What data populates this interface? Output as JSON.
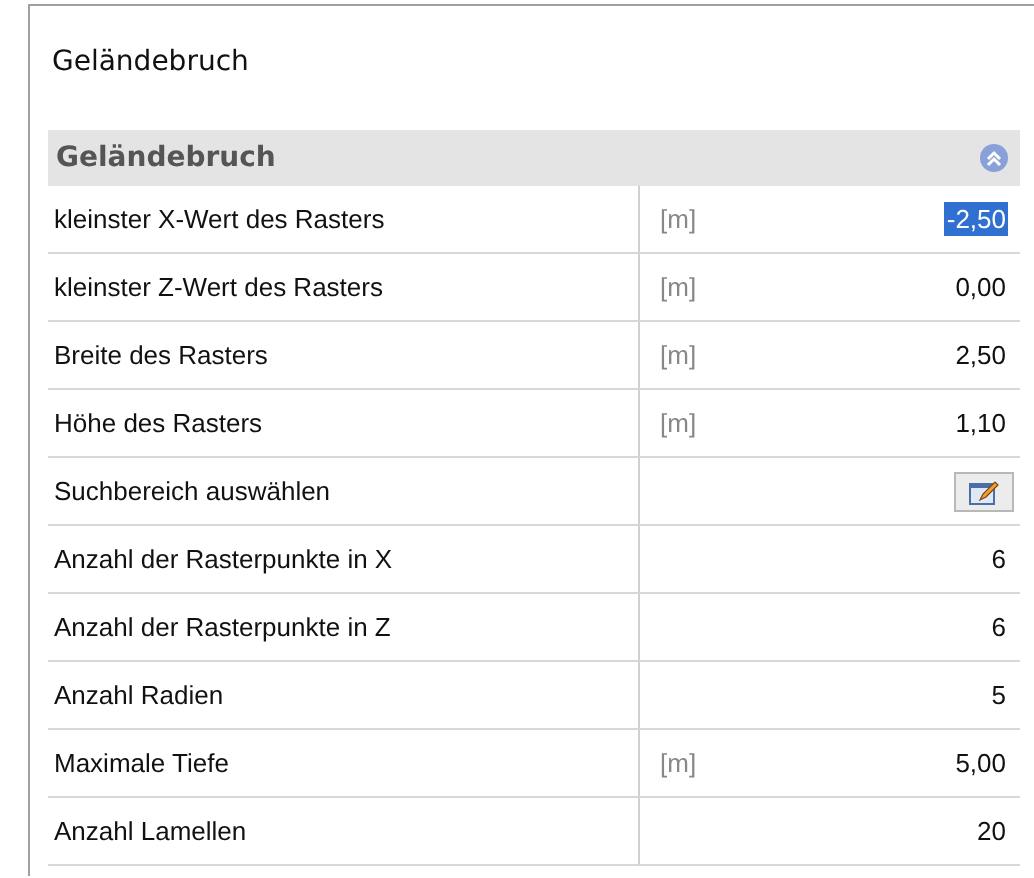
{
  "panel": {
    "title": "Geländebruch"
  },
  "section": {
    "title": "Geländebruch",
    "expanded": true
  },
  "rows": [
    {
      "kind": "value",
      "label": "kleinster X-Wert des Rasters",
      "unit": "[m]",
      "value": "-2,50",
      "selected": true
    },
    {
      "kind": "value",
      "label": "kleinster Z-Wert des Rasters",
      "unit": "[m]",
      "value": "0,00",
      "selected": false
    },
    {
      "kind": "value",
      "label": "Breite des Rasters",
      "unit": "[m]",
      "value": "2,50",
      "selected": false
    },
    {
      "kind": "value",
      "label": "Höhe des Rasters",
      "unit": "[m]",
      "value": "1,10",
      "selected": false
    },
    {
      "kind": "button",
      "label": "Suchbereich auswählen",
      "selected": false
    },
    {
      "kind": "value",
      "label": "Anzahl der Rasterpunkte in X",
      "value": "6",
      "selected": false
    },
    {
      "kind": "value",
      "label": "Anzahl der Rasterpunkte in Z",
      "value": "6",
      "selected": false
    },
    {
      "kind": "value",
      "label": "Anzahl Radien",
      "value": "5",
      "selected": false
    },
    {
      "kind": "value",
      "label": "Maximale Tiefe",
      "unit": "[m]",
      "value": "5,00",
      "selected": false
    },
    {
      "kind": "value",
      "label": "Anzahl Lamellen",
      "value": "20",
      "selected": false
    }
  ]
}
